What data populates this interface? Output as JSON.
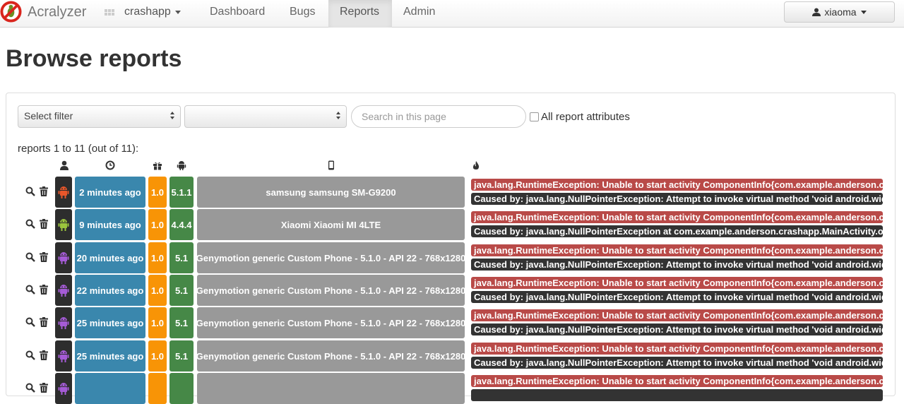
{
  "navbar": {
    "brand": "Acralyzer",
    "app_selector": "crashapp",
    "items": [
      "Dashboard",
      "Bugs",
      "Reports",
      "Admin"
    ],
    "active_item": "Reports",
    "user": "xiaoma"
  },
  "page": {
    "title": "Browse reports"
  },
  "filters": {
    "filter_select": "Select filter",
    "value_select": "",
    "search_placeholder": "Search in this page",
    "all_attributes_label": "All report attributes",
    "all_attributes_checked": false
  },
  "report_count": "reports 1 to 11 (out of 11):",
  "columns": [
    "user-icon",
    "clock-icon",
    "gift-icon",
    "android-icon",
    "phone-icon",
    "fire-icon"
  ],
  "reports": [
    {
      "avatar_color": "#e8562a",
      "time": "2 minutes ago",
      "version": "1.0",
      "android": "5.1.1",
      "device": "samsung samsung SM-G9200",
      "exception": "java.lang.RuntimeException: Unable to start activity ComponentInfo{com.example.anderson.crashapp/com.example.anderson.crashapp.MainActivity}",
      "cause": "Caused by: java.lang.NullPointerException: Attempt to invoke virtual method 'void android.widget.TextView.setText(java.lang.CharSequence)'"
    },
    {
      "avatar_color": "#9bc53d",
      "time": "9 minutes ago",
      "version": "1.0",
      "android": "4.4.4",
      "device": "Xiaomi Xiaomi MI 4LTE",
      "exception": "java.lang.RuntimeException: Unable to start activity ComponentInfo{com.example.anderson.crashapp/com.example.anderson.crashapp.MainActivity}",
      "cause": "Caused by: java.lang.NullPointerException at com.example.anderson.crashapp.MainActivity.onCreate(MainActivity.java)"
    },
    {
      "avatar_color": "#a55bd6",
      "time": "20 minutes ago",
      "version": "1.0",
      "android": "5.1",
      "device": "Genymotion generic Custom Phone - 5.1.0 - API 22 - 768x1280",
      "exception": "java.lang.RuntimeException: Unable to start activity ComponentInfo{com.example.anderson.crashapp/com.example.anderson.crashapp.MainActivity}",
      "cause": "Caused by: java.lang.NullPointerException: Attempt to invoke virtual method 'void android.widget.TextView.setText(java.lang.CharSequence)'"
    },
    {
      "avatar_color": "#a55bd6",
      "time": "22 minutes ago",
      "version": "1.0",
      "android": "5.1",
      "device": "Genymotion generic Custom Phone - 5.1.0 - API 22 - 768x1280",
      "exception": "java.lang.RuntimeException: Unable to start activity ComponentInfo{com.example.anderson.crashapp/com.example.anderson.crashapp.MainActivity}",
      "cause": "Caused by: java.lang.NullPointerException: Attempt to invoke virtual method 'void android.widget.TextView.setText(java.lang.CharSequence)'"
    },
    {
      "avatar_color": "#a55bd6",
      "time": "25 minutes ago",
      "version": "1.0",
      "android": "5.1",
      "device": "Genymotion generic Custom Phone - 5.1.0 - API 22 - 768x1280",
      "exception": "java.lang.RuntimeException: Unable to start activity ComponentInfo{com.example.anderson.crashapp/com.example.anderson.crashapp.MainActivity}",
      "cause": "Caused by: java.lang.NullPointerException: Attempt to invoke virtual method 'void android.widget.TextView.setText(java.lang.CharSequence)'"
    },
    {
      "avatar_color": "#a55bd6",
      "time": "25 minutes ago",
      "version": "1.0",
      "android": "5.1",
      "device": "Genymotion generic Custom Phone - 5.1.0 - API 22 - 768x1280",
      "exception": "java.lang.RuntimeException: Unable to start activity ComponentInfo{com.example.anderson.crashapp/com.example.anderson.crashapp.MainActivity}",
      "cause": "Caused by: java.lang.NullPointerException: Attempt to invoke virtual method 'void android.widget.TextView.setText(java.lang.CharSequence)'"
    },
    {
      "avatar_color": "#a55bd6",
      "time": "",
      "version": "",
      "android": "",
      "device": "",
      "exception": "java.lang.RuntimeException: Unable to start activity ComponentInfo{com.example.anderson.crashapp/com.example.anderson.crashapp.MainActivity}",
      "cause": ""
    }
  ]
}
